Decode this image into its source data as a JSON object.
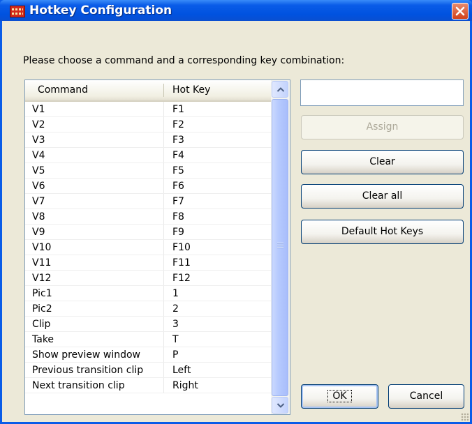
{
  "window": {
    "title": "Hotkey Configuration"
  },
  "instruction": "Please choose a command and a corresponding key combination:",
  "list": {
    "headers": {
      "command": "Command",
      "hotkey": "Hot Key"
    },
    "rows": [
      {
        "command": "V1",
        "key": "F1"
      },
      {
        "command": "V2",
        "key": "F2"
      },
      {
        "command": "V3",
        "key": "F3"
      },
      {
        "command": "V4",
        "key": "F4"
      },
      {
        "command": "V5",
        "key": "F5"
      },
      {
        "command": "V6",
        "key": "F6"
      },
      {
        "command": "V7",
        "key": "F7"
      },
      {
        "command": "V8",
        "key": "F8"
      },
      {
        "command": "V9",
        "key": "F9"
      },
      {
        "command": "V10",
        "key": "F10"
      },
      {
        "command": "V11",
        "key": "F11"
      },
      {
        "command": "V12",
        "key": "F12"
      },
      {
        "command": "Pic1",
        "key": "1"
      },
      {
        "command": "Pic2",
        "key": "2"
      },
      {
        "command": "Clip",
        "key": "3"
      },
      {
        "command": "Take",
        "key": "T"
      },
      {
        "command": "Show preview window",
        "key": "P"
      },
      {
        "command": "Previous transition clip",
        "key": "Left"
      },
      {
        "command": "Next transition clip",
        "key": "Right"
      }
    ]
  },
  "key_input": {
    "value": ""
  },
  "buttons": {
    "assign": "Assign",
    "clear": "Clear",
    "clear_all": "Clear all",
    "default_hotkeys": "Default Hot Keys",
    "ok": "OK",
    "cancel": "Cancel"
  },
  "colors": {
    "titlebar": "#0a5ce8",
    "dialog_face": "#ece9d8",
    "close_button": "#d2411b"
  }
}
